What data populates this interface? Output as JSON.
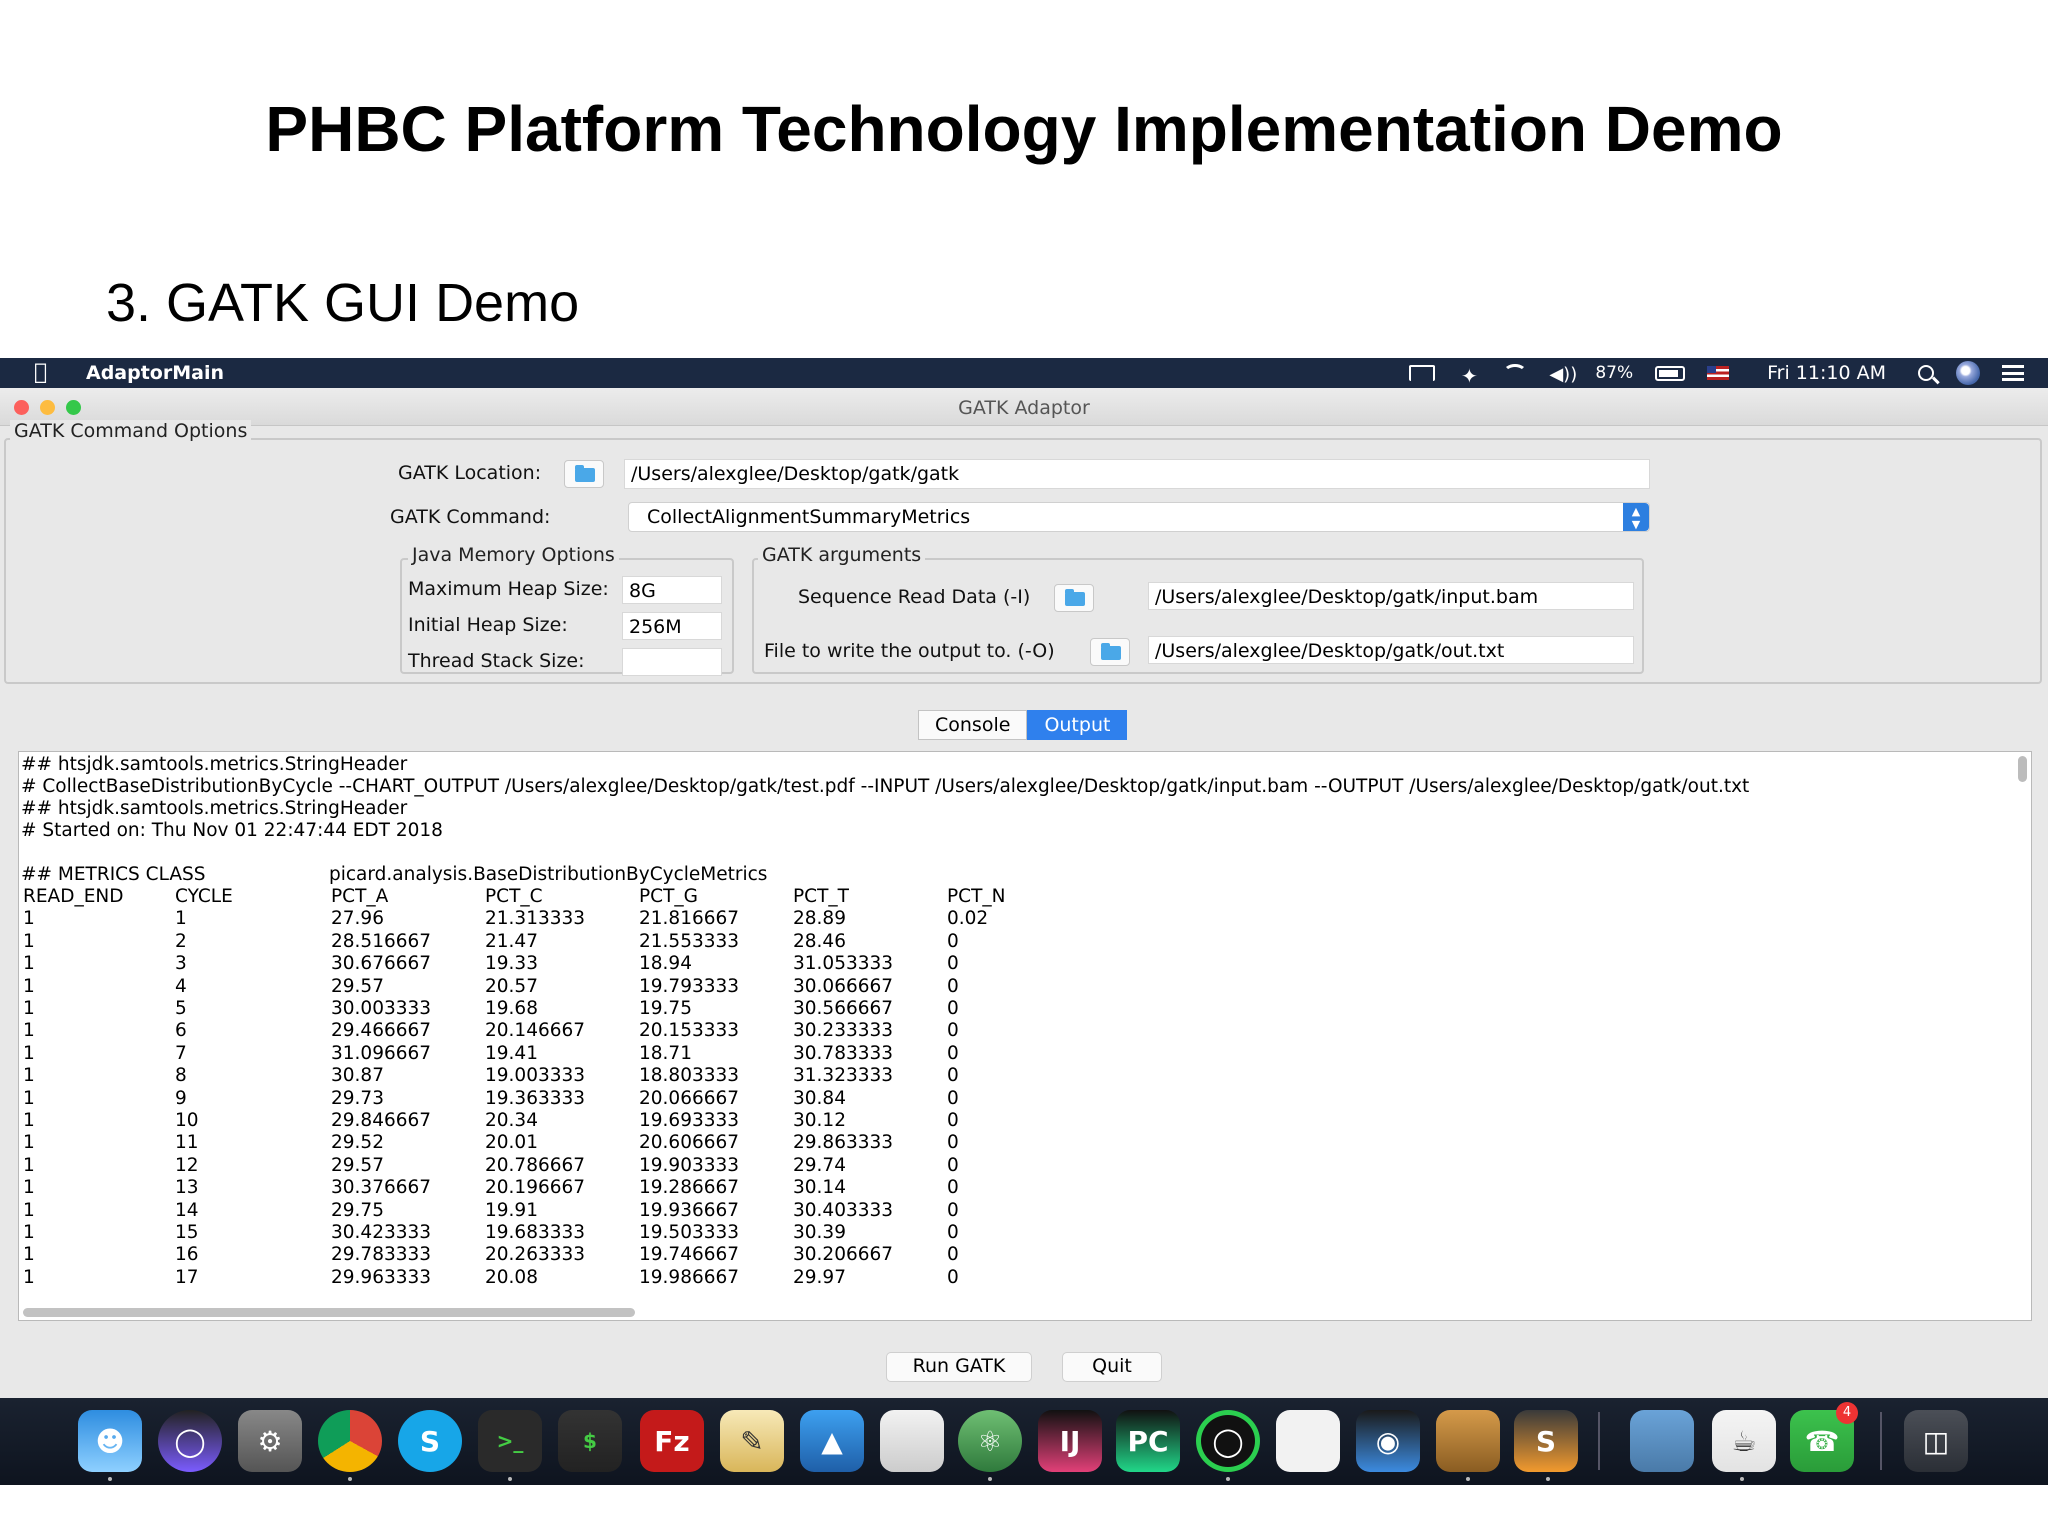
{
  "slide": {
    "title": "PHBC Platform Technology Implementation Demo",
    "subtitle": "3. GATK GUI Demo"
  },
  "menubar": {
    "app_name": "AdaptorMain",
    "battery": "87%",
    "clock": "Fri 11:10 AM",
    "icons": [
      "apple-icon",
      "airplay-icon",
      "bluetooth-icon",
      "wifi-icon",
      "volume-icon",
      "battery-icon",
      "flag-icon",
      "search-icon",
      "siri-icon",
      "list-icon"
    ]
  },
  "window": {
    "title": "GATK Adaptor",
    "command_options": {
      "legend": "GATK Command Options",
      "location_label": "GATK Location:",
      "location_value": "/Users/alexglee/Desktop/gatk/gatk",
      "command_label": "GATK Command:",
      "command_value": "CollectAlignmentSummaryMetrics"
    },
    "java_memory": {
      "legend": "Java Memory Options",
      "max_heap_label": "Maximum Heap Size:",
      "max_heap_value": "8G",
      "initial_heap_label": "Initial Heap Size:",
      "initial_heap_value": "256M",
      "thread_stack_label": "Thread Stack Size:",
      "thread_stack_value": ""
    },
    "gatk_arguments": {
      "legend": "GATK arguments",
      "input_label": "Sequence Read Data (-I)",
      "input_value": "/Users/alexglee/Desktop/gatk/input.bam",
      "output_label": "File to write the output to. (-O)",
      "output_value": "/Users/alexglee/Desktop/gatk/out.txt"
    },
    "tabs": [
      {
        "label": "Console",
        "active": false
      },
      {
        "label": "Output",
        "active": true
      }
    ],
    "output": {
      "header_lines": [
        "## htsjdk.samtools.metrics.StringHeader",
        "# CollectBaseDistributionByCycle  --CHART_OUTPUT /Users/alexglee/Desktop/gatk/test.pdf --INPUT /Users/alexglee/Desktop/gatk/input.bam --OUTPUT /Users/alexglee/Desktop/gatk/out.txt",
        "## htsjdk.samtools.metrics.StringHeader",
        "# Started on: Thu Nov 01 22:47:44 EDT 2018"
      ],
      "metrics_class_label": "## METRICS CLASS",
      "metrics_class_value": "picard.analysis.BaseDistributionByCycleMetrics",
      "columns": [
        "READ_END",
        "CYCLE",
        "PCT_A",
        "PCT_C",
        "PCT_G",
        "PCT_T",
        "PCT_N"
      ],
      "rows": [
        [
          "1",
          "1",
          "27.96",
          "21.313333",
          "21.816667",
          "28.89",
          "0.02"
        ],
        [
          "1",
          "2",
          "28.516667",
          "21.47",
          "21.553333",
          "28.46",
          "0"
        ],
        [
          "1",
          "3",
          "30.676667",
          "19.33",
          "18.94",
          "31.053333",
          "0"
        ],
        [
          "1",
          "4",
          "29.57",
          "20.57",
          "19.793333",
          "30.066667",
          "0"
        ],
        [
          "1",
          "5",
          "30.003333",
          "19.68",
          "19.75",
          "30.566667",
          "0"
        ],
        [
          "1",
          "6",
          "29.466667",
          "20.146667",
          "20.153333",
          "30.233333",
          "0"
        ],
        [
          "1",
          "7",
          "31.096667",
          "19.41",
          "18.71",
          "30.783333",
          "0"
        ],
        [
          "1",
          "8",
          "30.87",
          "19.003333",
          "18.803333",
          "31.323333",
          "0"
        ],
        [
          "1",
          "9",
          "29.73",
          "19.363333",
          "20.066667",
          "30.84",
          "0"
        ],
        [
          "1",
          "10",
          "29.846667",
          "20.34",
          "19.693333",
          "30.12",
          "0"
        ],
        [
          "1",
          "11",
          "29.52",
          "20.01",
          "20.606667",
          "29.863333",
          "0"
        ],
        [
          "1",
          "12",
          "29.57",
          "20.786667",
          "19.903333",
          "29.74",
          "0"
        ],
        [
          "1",
          "13",
          "30.376667",
          "20.196667",
          "19.286667",
          "30.14",
          "0"
        ],
        [
          "1",
          "14",
          "29.75",
          "19.91",
          "19.936667",
          "30.403333",
          "0"
        ],
        [
          "1",
          "15",
          "30.423333",
          "19.683333",
          "19.503333",
          "30.39",
          "0"
        ],
        [
          "1",
          "16",
          "29.783333",
          "20.263333",
          "19.746667",
          "30.206667",
          "0"
        ],
        [
          "1",
          "17",
          "29.963333",
          "20.08",
          "19.986667",
          "29.97",
          "0"
        ]
      ]
    },
    "buttons": {
      "run": "Run GATK",
      "quit": "Quit"
    }
  },
  "dock": {
    "apps": [
      "finder-icon",
      "siri-icon",
      "system-preferences-icon",
      "chrome-icon",
      "skype-icon",
      "terminal-icon",
      "terminal-alt-icon",
      "filezilla-icon",
      "textedit-icon",
      "keynote-icon",
      "pages-icon",
      "atom-icon",
      "intellij-icon",
      "pycharm-icon",
      "spinner-app-icon",
      "kindle-icon",
      "quicktime-icon",
      "box-app-icon",
      "sublime-icon",
      "preview-icon",
      "java-icon",
      "facetime-icon",
      "trash-icon"
    ],
    "facetime_badge": "4"
  }
}
